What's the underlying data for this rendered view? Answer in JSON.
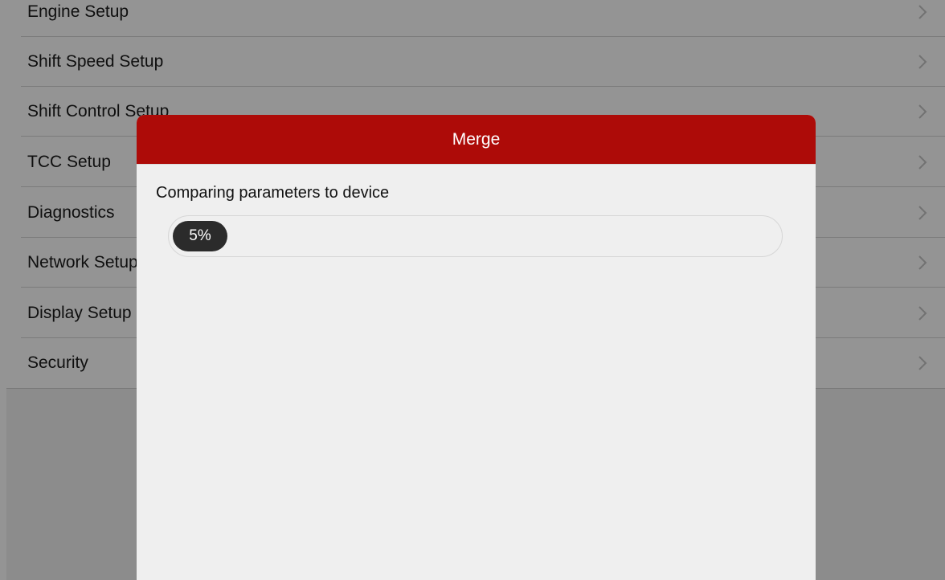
{
  "settings_list": {
    "items": [
      {
        "label": "Engine Setup"
      },
      {
        "label": "Shift Speed Setup"
      },
      {
        "label": "Shift Control Setup"
      },
      {
        "label": "TCC Setup"
      },
      {
        "label": "Diagnostics"
      },
      {
        "label": "Network Setup"
      },
      {
        "label": "Display Setup"
      },
      {
        "label": "Security"
      }
    ],
    "chevron_icon": "chevron-right-icon"
  },
  "dialog": {
    "title": "Merge",
    "status_text": "Comparing parameters to device",
    "progress": {
      "label": "5%",
      "fraction": 0.05
    },
    "colors": {
      "header": "#ad0b08",
      "progress_fill": "#2b2b2b"
    }
  }
}
